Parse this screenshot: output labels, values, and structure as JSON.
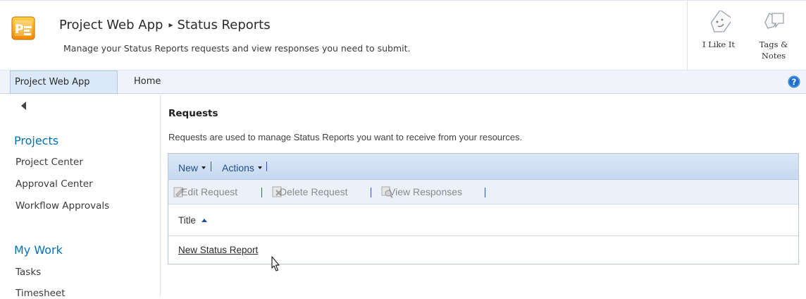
{
  "header": {
    "site_title": "Project Web App",
    "breadcrumb_separator": "▸",
    "page_title": "Status Reports",
    "description": "Manage your Status Reports requests and view responses you need to submit.",
    "logo_icon": "project-logo-icon"
  },
  "social": {
    "like_label": "I Like It",
    "tags_label_line1": "Tags &",
    "tags_label_line2": "Notes"
  },
  "top_nav": {
    "tabs": [
      {
        "label": "Project Web App",
        "selected": true
      },
      {
        "label": "Home",
        "selected": false
      }
    ],
    "help_icon": "help-icon"
  },
  "left_nav": {
    "sections": [
      {
        "heading": "Projects",
        "items": [
          "Project Center",
          "Approval Center",
          "Workflow Approvals"
        ]
      },
      {
        "heading": "My Work",
        "items": [
          "Tasks",
          "Timesheet"
        ]
      }
    ]
  },
  "main": {
    "title": "Requests",
    "description": "Requests are used to manage Status Reports you want to receive from your resources.",
    "menu": {
      "new_label": "New",
      "actions_label": "Actions"
    },
    "actions": {
      "edit": "Edit Request",
      "delete": "Delete Request",
      "view": "View Responses"
    },
    "columns": [
      {
        "label": "Title",
        "sort": "ascending"
      }
    ],
    "rows": [
      {
        "title": "New Status Report"
      }
    ]
  },
  "colors": {
    "accent": "#0072bc",
    "toolbar_text": "#1f4e8a",
    "disabled_text": "#8a8a8a"
  }
}
